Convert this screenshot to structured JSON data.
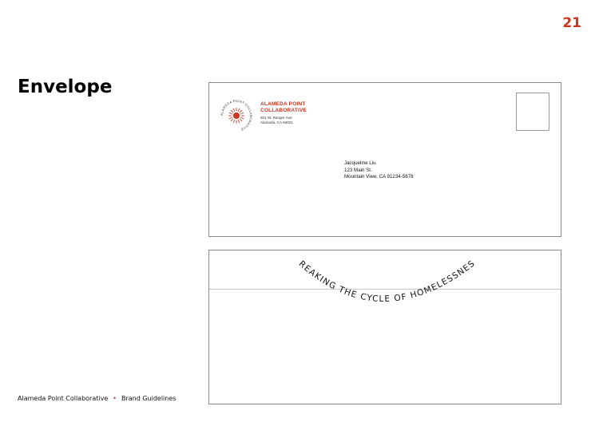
{
  "page_number": "21",
  "page_title": "Envelope",
  "envelope_front": {
    "logo": {
      "icon": "sun-seal-icon",
      "ring_text": "ALAMEDA POINT COLLABORATIVE"
    },
    "return_name_line1": "ALAMEDA POINT",
    "return_name_line2": "COLLABORATIVE",
    "return_address_line1": "501 W. Ranger Ave",
    "return_address_line2": "Alameda, CA 94621",
    "recipient_name": "Jacqueline Liu",
    "recipient_street": "123 Main St.",
    "recipient_city": "Mountain View, CA 91234-5678"
  },
  "envelope_back": {
    "tagline": "BREAKING THE CYCLE OF HOMELESSNESS"
  },
  "footer": {
    "org": "Alameda Point Collaborative",
    "section": "Brand Guidelines"
  },
  "colors": {
    "accent": "#c8361f",
    "border": "#8a8a8a"
  }
}
